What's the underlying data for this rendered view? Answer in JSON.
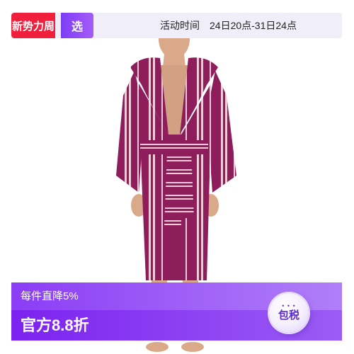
{
  "banner": {
    "new_badge": "新势力周",
    "pick_badge": "选",
    "event_label": "活动时间",
    "event_range": "24日20点-31日24点"
  },
  "promo": {
    "per_item_discount": "每件直降5%",
    "official_discount": "官方8.8折",
    "tax_badge": "包税",
    "tax_dots": "• • •"
  },
  "product": {
    "icon": "striped-hooded-bathrobe-image",
    "colors": {
      "robe": "#8e1d5c",
      "stripe": "#f2c9d9",
      "skin": "#d9a98a",
      "accent": "#8b3df6"
    }
  }
}
